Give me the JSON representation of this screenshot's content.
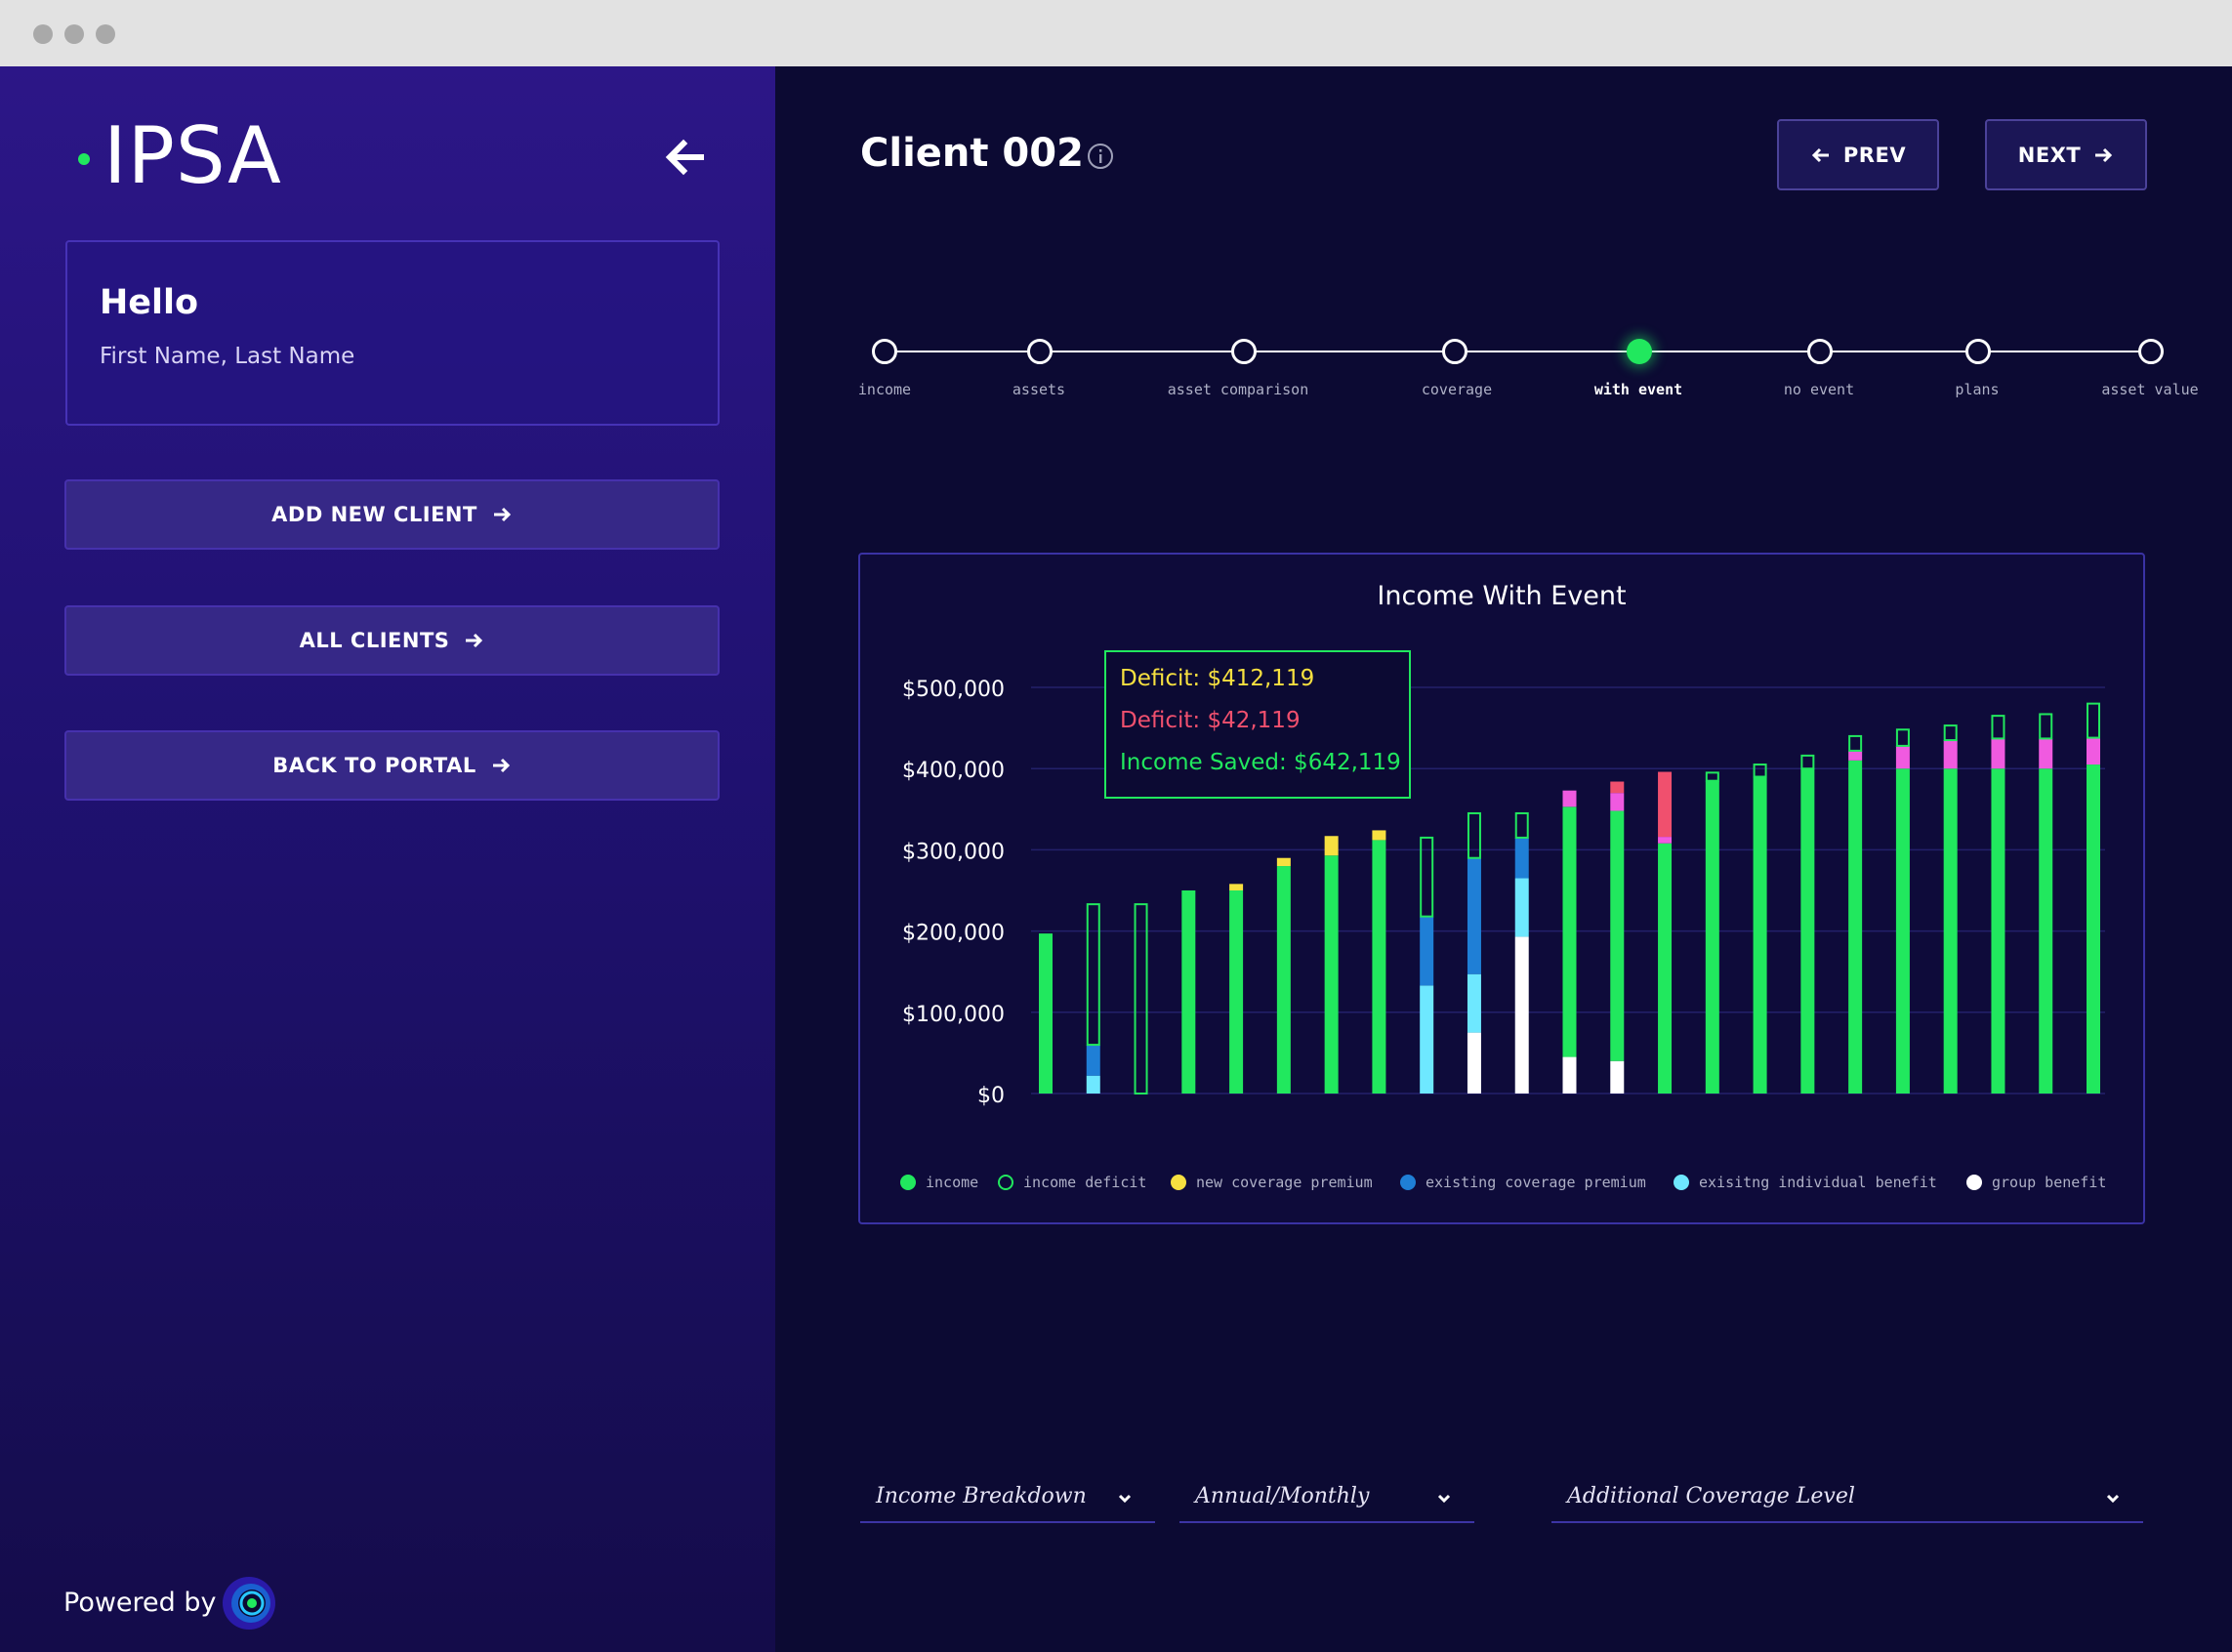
{
  "sidebar": {
    "logo": "IPSA",
    "hello_title": "Hello",
    "hello_name": "First Name, Last Name",
    "buttons": [
      "ADD NEW CLIENT",
      "ALL CLIENTS",
      "BACK TO PORTAL"
    ],
    "powered_by": "Powered by"
  },
  "header": {
    "client_title": "Client 002",
    "prev_label": "PREV",
    "next_label": "NEXT"
  },
  "stepper": {
    "steps": [
      "income",
      "assets",
      "asset comparison",
      "coverage",
      "with event",
      "no event",
      "plans",
      "asset value"
    ],
    "active": "with event"
  },
  "tooltip": {
    "line1": "Deficit: $412,119",
    "line2": "Deficit: $42,119",
    "line3": "Income Saved: $642,119"
  },
  "dropdowns": {
    "breakdown": "Income Breakdown",
    "period": "Annual/Monthly",
    "coverage": "Additional Coverage Level"
  },
  "colors": {
    "income": "#21e85e",
    "income_deficit": "#21e85e",
    "new_coverage_premium": "#f7e040",
    "existing_coverage_premium": "#1f7fd6",
    "existing_individual_benefit": "#6ee8ff",
    "group_benefit": "#ffffff",
    "pink": "#f05ae0",
    "red": "#f0506e"
  },
  "chart_data": {
    "type": "bar",
    "title": "Income With Event",
    "ylim": [
      0,
      500000
    ],
    "y_ticks": [
      "$0",
      "$100,000",
      "$200,000",
      "$300,000",
      "$400,000",
      "$500,000"
    ],
    "legend": [
      "income",
      "income deficit",
      "new coverage premium",
      "existing coverage premium",
      "exisitng individual benefit",
      "group benefit"
    ],
    "bars": [
      {
        "income": 197000,
        "deficit": 0,
        "new_premium": 0,
        "existing_premium": 0,
        "individual_benefit": 0,
        "group_benefit": 0,
        "pink": 0,
        "red": 0
      },
      {
        "income": 0,
        "deficit": 173000,
        "new_premium": 0,
        "existing_premium": 38000,
        "individual_benefit": 22000,
        "group_benefit": 0,
        "pink": 0,
        "red": 0
      },
      {
        "income": 0,
        "deficit": 233000,
        "new_premium": 0,
        "existing_premium": 0,
        "individual_benefit": 0,
        "group_benefit": 0,
        "pink": 0,
        "red": 0
      },
      {
        "income": 250000,
        "deficit": 0,
        "new_premium": 0,
        "existing_premium": 0,
        "individual_benefit": 0,
        "group_benefit": 0,
        "pink": 0,
        "red": 0
      },
      {
        "income": 250000,
        "deficit": 0,
        "new_premium": 8000,
        "existing_premium": 0,
        "individual_benefit": 0,
        "group_benefit": 0,
        "pink": 0,
        "red": 0
      },
      {
        "income": 280000,
        "deficit": 0,
        "new_premium": 10000,
        "existing_premium": 0,
        "individual_benefit": 0,
        "group_benefit": 0,
        "pink": 0,
        "red": 0
      },
      {
        "income": 293000,
        "deficit": 0,
        "new_premium": 24000,
        "existing_premium": 0,
        "individual_benefit": 0,
        "group_benefit": 0,
        "pink": 0,
        "red": 0
      },
      {
        "income": 312000,
        "deficit": 0,
        "new_premium": 12000,
        "existing_premium": 0,
        "individual_benefit": 0,
        "group_benefit": 0,
        "pink": 0,
        "red": 0
      },
      {
        "income": 0,
        "deficit": 97000,
        "new_premium": 0,
        "existing_premium": 85000,
        "individual_benefit": 133000,
        "group_benefit": 0,
        "pink": 0,
        "red": 0
      },
      {
        "income": 0,
        "deficit": 55000,
        "new_premium": 0,
        "existing_premium": 143000,
        "individual_benefit": 72000,
        "group_benefit": 75000,
        "pink": 0,
        "red": 0
      },
      {
        "income": 0,
        "deficit": 30000,
        "new_premium": 0,
        "existing_premium": 50000,
        "individual_benefit": 72000,
        "group_benefit": 193000,
        "pink": 0,
        "red": 0
      },
      {
        "income": 308000,
        "deficit": 0,
        "new_premium": 0,
        "existing_premium": 0,
        "individual_benefit": 0,
        "group_benefit": 45000,
        "pink": 20000,
        "red": 0
      },
      {
        "income": 308000,
        "deficit": 0,
        "new_premium": 0,
        "existing_premium": 0,
        "individual_benefit": 0,
        "group_benefit": 40000,
        "pink": 22000,
        "red": 14000
      },
      {
        "income": 308000,
        "deficit": 0,
        "new_premium": 0,
        "existing_premium": 0,
        "individual_benefit": 0,
        "group_benefit": 0,
        "pink": 8000,
        "red": 80000
      },
      {
        "income": 385000,
        "deficit": 10000,
        "new_premium": 0,
        "existing_premium": 0,
        "individual_benefit": 0,
        "group_benefit": 0,
        "pink": 0,
        "red": 0
      },
      {
        "income": 390000,
        "deficit": 15000,
        "new_premium": 0,
        "existing_premium": 0,
        "individual_benefit": 0,
        "group_benefit": 0,
        "pink": 0,
        "red": 0
      },
      {
        "income": 400000,
        "deficit": 16000,
        "new_premium": 0,
        "existing_premium": 0,
        "individual_benefit": 0,
        "group_benefit": 0,
        "pink": 0,
        "red": 0
      },
      {
        "income": 410000,
        "deficit": 18000,
        "new_premium": 0,
        "existing_premium": 0,
        "individual_benefit": 0,
        "group_benefit": 0,
        "pink": 12000,
        "red": 0
      },
      {
        "income": 400000,
        "deficit": 20000,
        "new_premium": 0,
        "existing_premium": 0,
        "individual_benefit": 0,
        "group_benefit": 0,
        "pink": 28000,
        "red": 0
      },
      {
        "income": 400000,
        "deficit": 18000,
        "new_premium": 0,
        "existing_premium": 0,
        "individual_benefit": 0,
        "group_benefit": 0,
        "pink": 35000,
        "red": 0
      },
      {
        "income": 400000,
        "deficit": 28000,
        "new_premium": 0,
        "existing_premium": 0,
        "individual_benefit": 0,
        "group_benefit": 0,
        "pink": 37000,
        "red": 0
      },
      {
        "income": 400000,
        "deficit": 30000,
        "new_premium": 0,
        "existing_premium": 0,
        "individual_benefit": 0,
        "group_benefit": 0,
        "pink": 37000,
        "red": 0
      },
      {
        "income": 405000,
        "deficit": 42000,
        "new_premium": 0,
        "existing_premium": 0,
        "individual_benefit": 0,
        "group_benefit": 0,
        "pink": 33000,
        "red": 0
      }
    ]
  }
}
